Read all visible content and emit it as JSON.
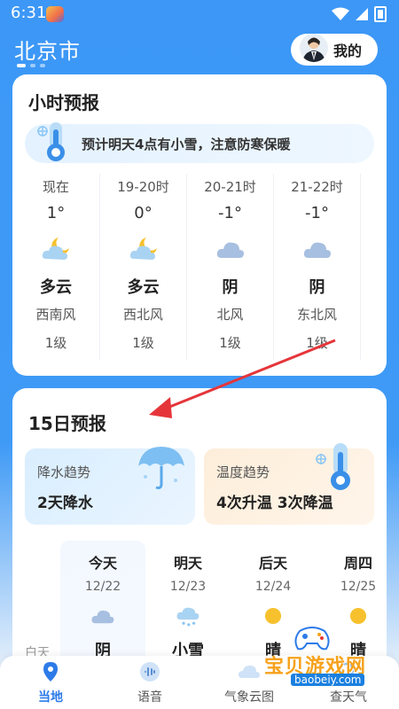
{
  "status_bar": {
    "time": "6:31"
  },
  "header": {
    "city": "北京市",
    "mine_label": "我的"
  },
  "hourly": {
    "title": "小时预报",
    "alert": "预计明天4点有小雪，注意防寒保暖",
    "items": [
      {
        "time": "现在",
        "temp": "1°",
        "cond": "多云",
        "wind": "西南风",
        "level": "1级",
        "icon": "cloudy-moon-icon"
      },
      {
        "time": "19-20时",
        "temp": "0°",
        "cond": "多云",
        "wind": "西北风",
        "level": "1级",
        "icon": "cloudy-moon-icon"
      },
      {
        "time": "20-21时",
        "temp": "-1°",
        "cond": "阴",
        "wind": "北风",
        "level": "1级",
        "icon": "overcast-cloud-icon"
      },
      {
        "time": "21-22时",
        "temp": "-1°",
        "cond": "阴",
        "wind": "东北风",
        "level": "1级",
        "icon": "overcast-cloud-icon"
      }
    ]
  },
  "forecast15": {
    "title": "15日预报",
    "rain_trend": {
      "title": "降水趋势",
      "value": "2天降水"
    },
    "temp_trend": {
      "title": "温度趋势",
      "value": "4次升温 3次降温"
    },
    "daytime_label": "白天",
    "days": [
      {
        "name": "今天",
        "date": "12/22",
        "cond": "阴",
        "icon": "overcast-cloud-icon"
      },
      {
        "name": "明天",
        "date": "12/23",
        "cond": "小雪",
        "icon": "light-snow-icon"
      },
      {
        "name": "后天",
        "date": "12/24",
        "cond": "晴",
        "icon": "sunny-icon"
      },
      {
        "name": "周四",
        "date": "12/25",
        "cond": "晴",
        "icon": "sunny-icon"
      }
    ]
  },
  "nav": {
    "local": "当地",
    "voice": "语音",
    "cloud_map": "气象云图",
    "check": "查天气"
  },
  "watermark": {
    "text": "宝贝游戏网",
    "url": "baobeiy.com"
  },
  "colors": {
    "primary": "#3c97f6",
    "accent_arrow": "#e5353a"
  }
}
